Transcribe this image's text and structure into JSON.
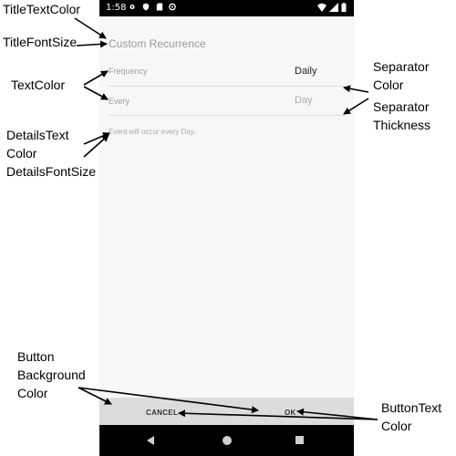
{
  "phone": {
    "status": {
      "time": "1:58"
    },
    "title": "Custom Recurrence",
    "rows": [
      {
        "label": "Frequency",
        "value": "Daily"
      },
      {
        "label": "Every",
        "value": "Day"
      }
    ],
    "details": "Event will occur every Day.",
    "buttons": {
      "cancel": "CANCEL",
      "ok": "OK"
    }
  },
  "annotations": {
    "title_text_color": "TitleTextColor",
    "title_font_size": "TitleFontSize",
    "text_color": "TextColor",
    "details_line1": "DetailsText",
    "details_line2": "Color",
    "details_line3": "DetailsFontSize",
    "separator_color_line1": "Separator",
    "separator_color_line2": "Color",
    "separator_thickness_line1": "Separator",
    "separator_thickness_line2": "Thickness",
    "button_bg_line1": "Button",
    "button_bg_line2": "Background",
    "button_bg_line3": "Color",
    "button_text_line1": "ButtonText",
    "button_text_line2": "Color"
  }
}
